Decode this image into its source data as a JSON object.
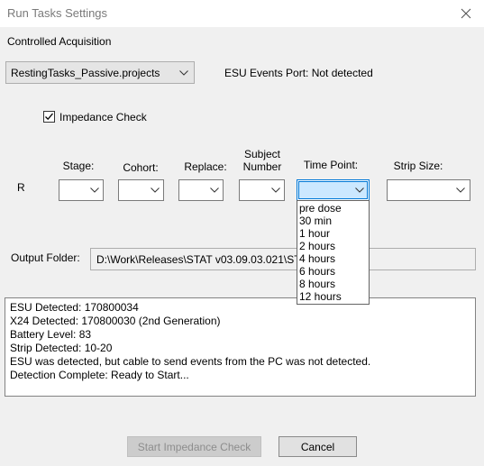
{
  "window": {
    "title": "Run Tasks Settings"
  },
  "group": {
    "label": "Controlled Acquisition"
  },
  "project_select": {
    "value": "RestingTasks_Passive.projects"
  },
  "esu_port": {
    "text": "ESU Events Port: Not detected"
  },
  "impedance": {
    "label": "Impedance Check",
    "checked": true
  },
  "columns": {
    "stage": "Stage:",
    "cohort": "Cohort:",
    "replace": "Replace:",
    "subject_line1": "Subject",
    "subject_line2": "Number",
    "time_point": "Time Point:",
    "strip_size": "Strip Size:"
  },
  "row_label": "R",
  "time_point_options": [
    "pre dose",
    "30 min",
    "1 hour",
    "2 hours",
    "4 hours",
    "6 hours",
    "8 hours",
    "12 hours"
  ],
  "output": {
    "label": "Output Folder:",
    "path": "D:\\Work\\Releases\\STAT v03.09.03.021\\STAT\\Data\\"
  },
  "log": [
    "ESU Detected: 170800034",
    "X24 Detected: 170800030 (2nd Generation)",
    "Battery Level: 83",
    "Strip Detected: 10-20",
    "ESU was detected, but cable to send events from the PC was not detected.",
    "Detection Complete: Ready to Start..."
  ],
  "buttons": {
    "start": "Start Impedance Check",
    "cancel": "Cancel"
  },
  "colors": {
    "background": "#f0f0f0",
    "focus_border": "#0078d7",
    "focus_fill": "#cce8ff"
  }
}
